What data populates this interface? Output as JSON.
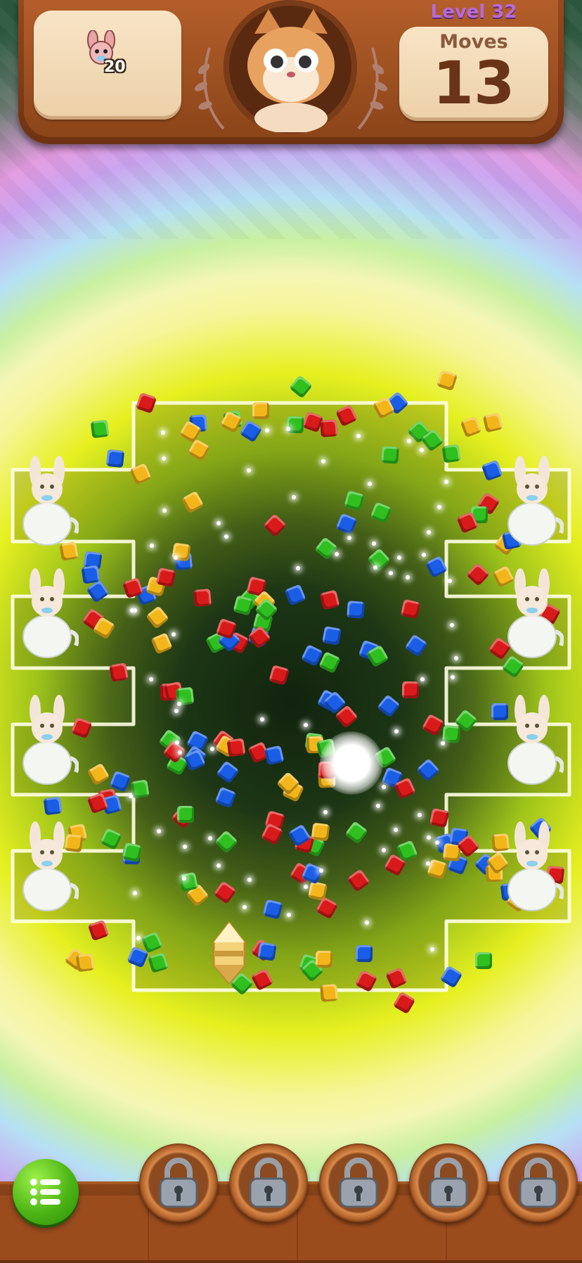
{
  "header": {
    "goal": {
      "icon": "bunny-goal-icon",
      "count": "20"
    },
    "level_label": "Level 32",
    "moves_label": "Moves",
    "moves_value": "13",
    "character": "cat-avatar"
  },
  "board": {
    "effect": "rainbow-color-bomb-explosion",
    "piece_colors": {
      "red": "#d91a1a",
      "blue": "#1a5ee6",
      "green": "#2fbf1f",
      "yellow": "#f3b61a"
    },
    "side_items_left": [
      "bunny-teapot",
      "bunny-teapot",
      "bunny-teapot",
      "bunny-teapot"
    ],
    "side_items_right": [
      "bunny-teapot",
      "bunny-teapot",
      "bunny-teapot",
      "bunny-teapot"
    ],
    "booster_on_board": "rocket-booster"
  },
  "bottom_bar": {
    "menu_icon": "list-menu-icon",
    "booster_slots": [
      {
        "icon": "padlock-icon",
        "locked": true
      },
      {
        "icon": "padlock-icon",
        "locked": true
      },
      {
        "icon": "padlock-icon",
        "locked": true
      },
      {
        "icon": "padlock-icon",
        "locked": true
      },
      {
        "icon": "padlock-icon",
        "locked": true
      }
    ]
  }
}
